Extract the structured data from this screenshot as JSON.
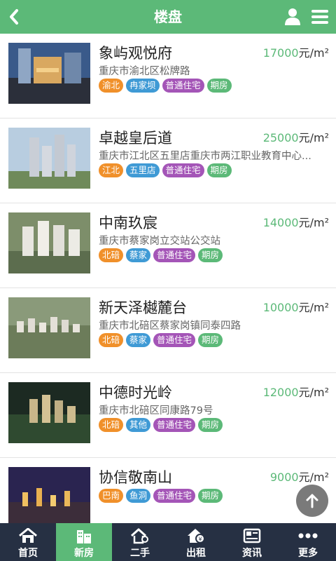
{
  "header": {
    "title": "楼盘",
    "back_icon": "chevron-left-icon",
    "user_icon": "user-icon",
    "menu_icon": "menu-icon",
    "background": "#5cb978"
  },
  "listings": [
    {
      "name": "象屿观悦府",
      "price": "17000",
      "unit": "元/m²",
      "address": "重庆市渝北区松牌路",
      "tags": [
        "渝北",
        "冉家坝",
        "普通住宅",
        "期房"
      ]
    },
    {
      "name": "卓越皇后道",
      "price": "25000",
      "unit": "元/m²",
      "address": "重庆市江北区五里店重庆市两江职业教育中心...",
      "tags": [
        "江北",
        "五里店",
        "普通住宅",
        "期房"
      ]
    },
    {
      "name": "中南玖宸",
      "price": "14000",
      "unit": "元/m²",
      "address": "重庆市蔡家岗立交站公交站",
      "tags": [
        "北碚",
        "蔡家",
        "普通住宅",
        "期房"
      ]
    },
    {
      "name": "新天泽樾麓台",
      "price": "10000",
      "unit": "元/m²",
      "address": "重庆市北碚区蔡家岗镇同泰四路",
      "tags": [
        "北碚",
        "蔡家",
        "普通住宅",
        "期房"
      ]
    },
    {
      "name": "中德时光岭",
      "price": "12000",
      "unit": "元/m²",
      "address": "重庆市北碚区同康路79号",
      "tags": [
        "北碚",
        "其他",
        "普通住宅",
        "期房"
      ]
    },
    {
      "name": "协信敬南山",
      "price": "9000",
      "unit": "元/m²",
      "address": "",
      "tags": [
        "巴南",
        "鱼洞",
        "普通住宅",
        "期房"
      ]
    }
  ],
  "scroll_top_icon": "arrow-up-icon",
  "footer": {
    "items": [
      {
        "label": "首页",
        "icon": "home-icon",
        "active": false
      },
      {
        "label": "新房",
        "icon": "building-icon",
        "active": true
      },
      {
        "label": "二手",
        "icon": "house-key-icon",
        "active": false
      },
      {
        "label": "出租",
        "icon": "house-coin-icon",
        "active": false
      },
      {
        "label": "资讯",
        "icon": "newspaper-icon",
        "active": false
      },
      {
        "label": "更多",
        "icon": "more-dots-icon",
        "active": false
      }
    ],
    "active_color": "#5cb978",
    "background": "#263043"
  }
}
